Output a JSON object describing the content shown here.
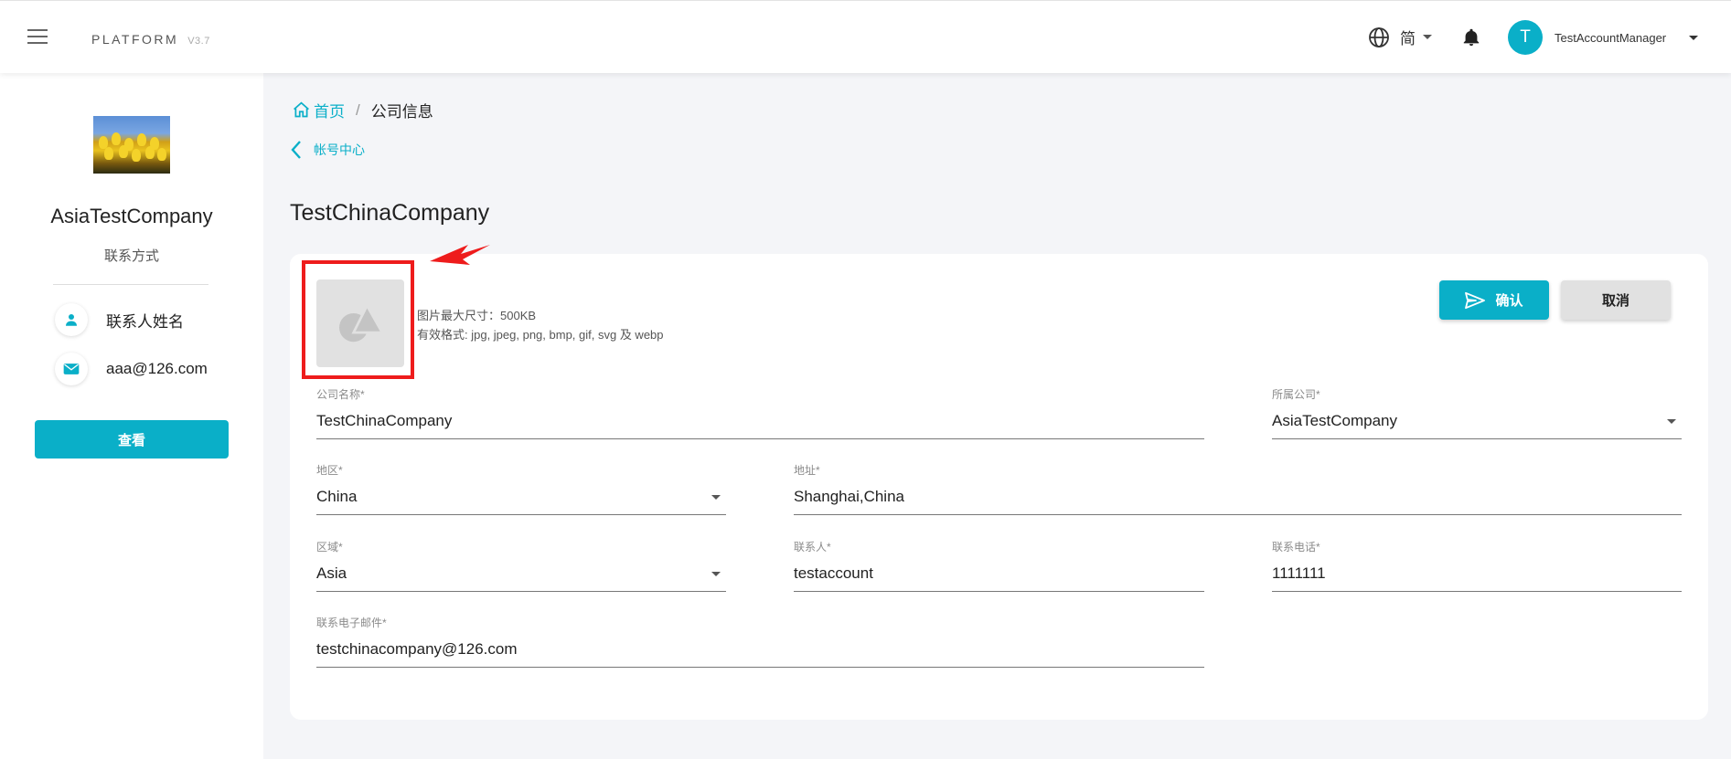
{
  "app": {
    "brand": "PLATFORM",
    "version": "V3.7"
  },
  "header": {
    "language": "简",
    "user_initial": "T",
    "user_name": "TestAccountManager"
  },
  "sidebar": {
    "company_name": "AsiaTestCompany",
    "contact_title": "联系方式",
    "contact_person": "联系人姓名",
    "contact_email": "aaa@126.com",
    "view_button": "查看"
  },
  "breadcrumb": {
    "home": "首页",
    "separator": "/",
    "current": "公司信息"
  },
  "back_link": "帐号中心",
  "page_title": "TestChinaCompany",
  "upload": {
    "max_size": "图片最大尺寸：500KB",
    "formats": "有效格式: jpg, jpeg, png, bmp, gif, svg 及 webp"
  },
  "actions": {
    "confirm": "确认",
    "cancel": "取消"
  },
  "form": {
    "company_name": {
      "label": "公司名称*",
      "value": "TestChinaCompany"
    },
    "parent_company": {
      "label": "所属公司*",
      "value": "AsiaTestCompany"
    },
    "region": {
      "label": "地区*",
      "value": "China"
    },
    "address": {
      "label": "地址*",
      "value": "Shanghai,China"
    },
    "area": {
      "label": "区域*",
      "value": "Asia"
    },
    "contact": {
      "label": "联系人*",
      "value": "testaccount"
    },
    "phone": {
      "label": "联系电话*",
      "value": "1111111"
    },
    "email": {
      "label": "联系电子邮件*",
      "value": "testchinacompany@126.com"
    }
  },
  "colors": {
    "accent": "#0aafc8",
    "annotation": "#ee1c1c",
    "button_grey": "#e1e1e1"
  }
}
